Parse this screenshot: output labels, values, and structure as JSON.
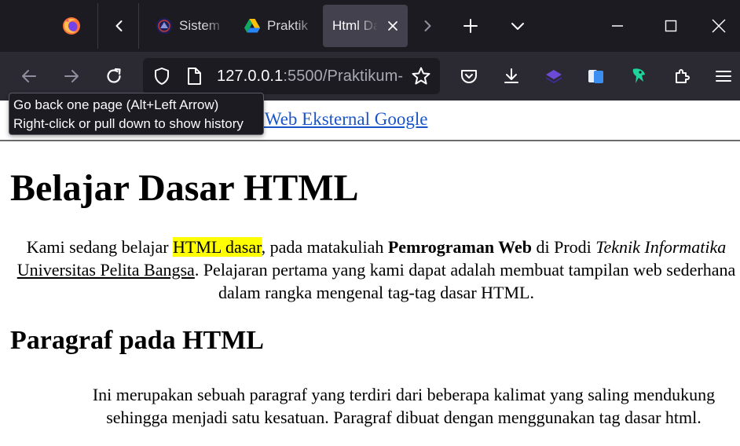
{
  "browser": {
    "tabs": [
      {
        "title": "Sistem",
        "favicon": "university-logo-icon",
        "active": false
      },
      {
        "title": "Praktik",
        "favicon": "google-drive-icon",
        "active": false
      },
      {
        "title": "Html Da",
        "favicon": "",
        "active": true
      }
    ],
    "url": {
      "host": "127.0.0.1",
      "rest": ":5500/Praktikum-"
    },
    "tooltip": {
      "line1": "Go back one page (Alt+Left Arrow)",
      "line2": "Right-click or pull down to show history"
    },
    "colors": {
      "tabbar": "#1c1b22",
      "toolbar": "#2b2a33",
      "active_tab": "#42414d"
    }
  },
  "page": {
    "top_link": "n Web Eksternal Google",
    "h1": "Belajar Dasar HTML",
    "intro": {
      "t1": "Kami sedang belajar ",
      "highlight": "HTML dasar",
      "t2": ", pada matakuliah ",
      "bold": "Pemrograman Web",
      "t3": " di Prodi ",
      "italic": "Teknik Informatika",
      "t4": " ",
      "underline": "Universitas Pelita Bangsa",
      "t5": ". Pelajaran pertama yang kami dapat adalah membuat tampilan web sederhana dalam rangka mengenal tag-tag dasar HTML."
    },
    "h2": "Paragraf pada HTML",
    "paragraph": {
      "line1": "Ini merupakan sebuah paragraf yang terdiri dari beberapa kalimat yang saling mendukung",
      "line2": "sehingga menjadi satu kesatuan. Paragraf dibuat dengan menggunakan tag dasar html."
    },
    "colors": {
      "link": "#1a55c8",
      "highlight": "#ffff00"
    }
  }
}
